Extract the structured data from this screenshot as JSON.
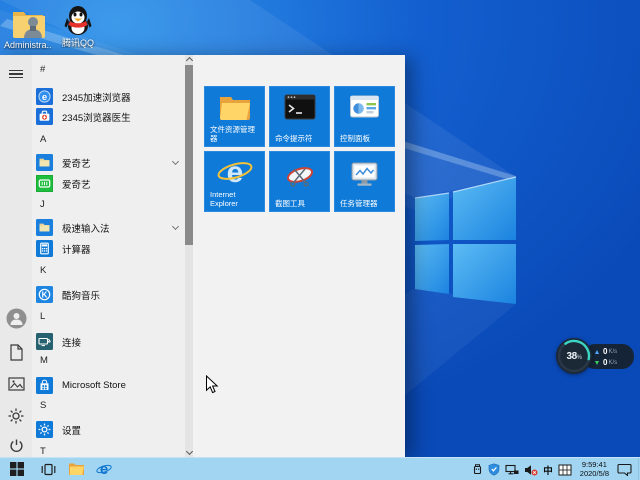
{
  "desktop": {
    "icons": [
      {
        "label": "Administra...",
        "icon": "user-folder-icon"
      },
      {
        "label": "腾讯QQ",
        "icon": "qq-penguin-icon"
      }
    ]
  },
  "start_menu": {
    "list": {
      "sections": [
        {
          "header": "#",
          "items": [
            {
              "label": "2345加速浏览器",
              "icon": "2345-browser-icon"
            },
            {
              "label": "2345浏览器医生",
              "icon": "2345-doctor-icon"
            }
          ]
        },
        {
          "header": "A",
          "items": [
            {
              "label": "爱奇艺",
              "icon": "folder-icon",
              "expandable": true
            },
            {
              "label": "爱奇艺",
              "icon": "iqiyi-icon"
            }
          ]
        },
        {
          "header": "J",
          "items": [
            {
              "label": "极速输入法",
              "icon": "folder-icon",
              "expandable": true
            },
            {
              "label": "计算器",
              "icon": "calculator-icon"
            }
          ]
        },
        {
          "header": "K",
          "items": [
            {
              "label": "酷狗音乐",
              "icon": "kugou-icon"
            }
          ]
        },
        {
          "header": "L",
          "items": [
            {
              "label": "连接",
              "icon": "connect-icon"
            }
          ]
        },
        {
          "header": "M",
          "items": [
            {
              "label": "Microsoft Store",
              "icon": "store-icon"
            }
          ]
        },
        {
          "header": "S",
          "items": [
            {
              "label": "设置",
              "icon": "settings-icon"
            }
          ]
        },
        {
          "header": "T",
          "items": []
        }
      ]
    },
    "tiles": [
      {
        "label": "文件资源管理器",
        "icon": "file-explorer-icon"
      },
      {
        "label": "命令提示符",
        "icon": "command-prompt-icon"
      },
      {
        "label": "控制面板",
        "icon": "control-panel-icon"
      },
      {
        "label": "Internet Explorer",
        "icon": "internet-explorer-icon"
      },
      {
        "label": "截图工具",
        "icon": "snipping-tool-icon"
      },
      {
        "label": "任务管理器",
        "icon": "task-manager-icon"
      }
    ],
    "rail_icons": [
      "hamburger-icon",
      "user-avatar",
      "document-icon",
      "pictures-icon",
      "gear-icon",
      "power-icon"
    ]
  },
  "net_widget": {
    "percent": "38",
    "percent_unit": "%",
    "up": {
      "value": "0",
      "unit": "K/s"
    },
    "down": {
      "value": "0",
      "unit": "K/s"
    },
    "accent": "#3ad6c3"
  },
  "taskbar": {
    "buttons": [
      "start-button",
      "task-view-button",
      "file-explorer-button",
      "browser-button"
    ],
    "tray": {
      "icons": [
        "usb-icon",
        "shield-icon",
        "network-icon",
        "volume-muted-icon",
        "ime-pad-icon",
        "action-center-icon"
      ],
      "ime_lang": "中",
      "time": "9:59:41",
      "date": "2020/5/8"
    }
  },
  "colors": {
    "tile_blue": "#0f7ad7",
    "taskbar_blue": "#a2d5f2",
    "menu_bg": "#efefef",
    "wallpaper_deep": "#0a4ab8",
    "widget_accent": "#3ad6c3"
  }
}
